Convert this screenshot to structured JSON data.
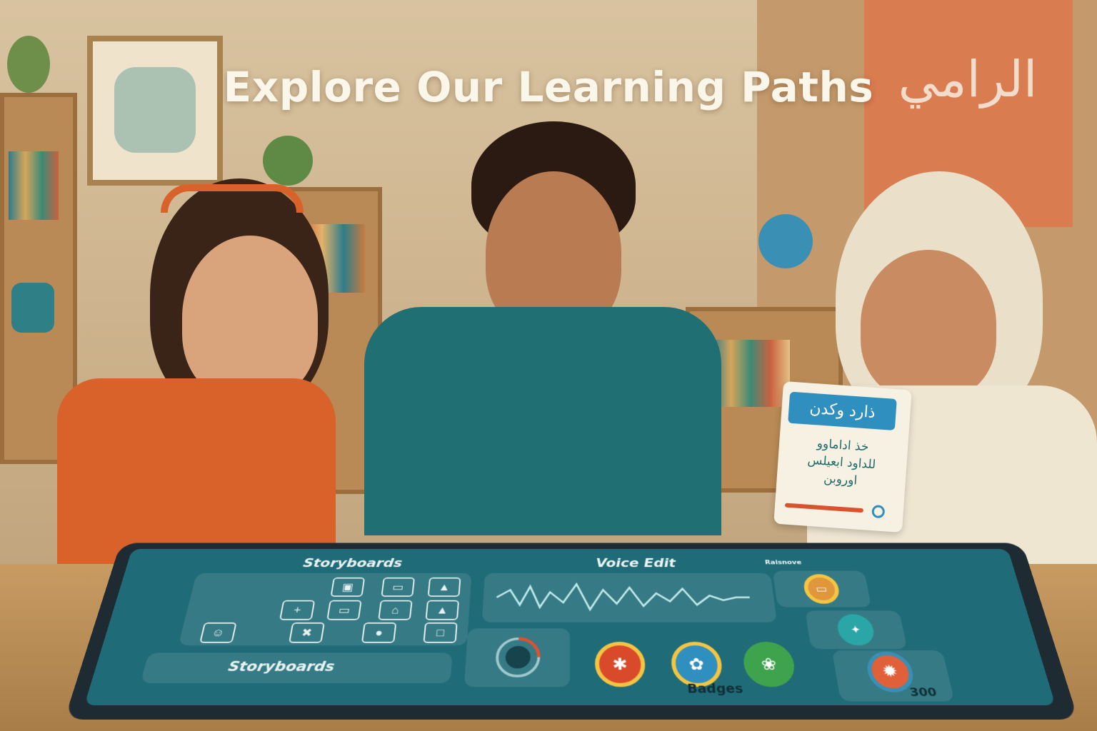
{
  "headline": "Explore Our Learning Paths",
  "tablet": {
    "storyboards_title": "Storyboards",
    "voice_title": "Voice Edit",
    "side_title": "Raisnove",
    "storyboards_button": "Storyboards",
    "badges_label": "Badges",
    "score": "300",
    "grid_icons": [
      "image-icon",
      "frame-icon",
      "mountain-icon",
      "add-icon",
      "frame-icon",
      "house-icon",
      "mountain-icon",
      "face-icon",
      "tools-icon",
      "microphone-icon",
      "chat-icon"
    ],
    "badges": [
      {
        "icon": "star-badge-icon",
        "color": "#d94a2b"
      },
      {
        "icon": "flower-badge-icon",
        "color": "#2f8fbf"
      },
      {
        "icon": "leaf-badge-icon",
        "color": "#3fa34d"
      },
      {
        "icon": "sparkle-badge-icon",
        "color": "#e0603a"
      }
    ],
    "side_icons": [
      "book-icon",
      "puzzle-icon"
    ]
  },
  "card": {
    "heading": "ذارد وكدن",
    "lines": [
      "خذ اداماوو",
      "للداود ابعيلس",
      "اوروبن"
    ]
  },
  "poster_text": "الرامي",
  "colors": {
    "screen": "#1f6b78",
    "accent_orange": "#d97c4f",
    "heading_text": "#fbf6ea"
  }
}
